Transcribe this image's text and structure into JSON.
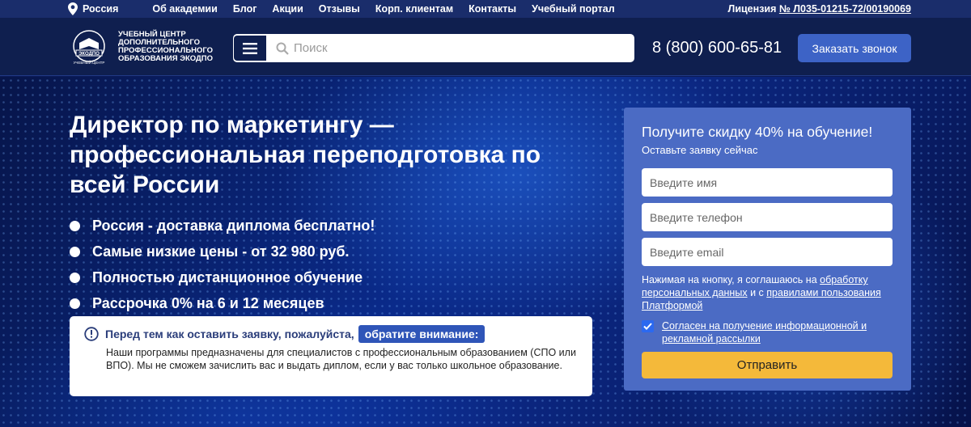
{
  "topbar": {
    "region": "Россия",
    "nav": [
      "Об академии",
      "Блог",
      "Акции",
      "Отзывы",
      "Корп. клиентам",
      "Контакты",
      "Учебный портал"
    ],
    "license_label": "Лицензия",
    "license_number": "№ Л035-01215-72/00190069"
  },
  "header": {
    "logo_text": "Учебный центр дополнительного профессионального образования Экодпо",
    "logo_emblem_text_top": "ЭКОДПО",
    "logo_emblem_text_bottom": "УЧЕБНЫЙ ЦЕНТР",
    "search_placeholder": "Поиск",
    "phone": "8 (800) 600-65-81",
    "call_button": "Заказать звонок"
  },
  "hero": {
    "title": "Директор по маркетингу — профессиональная переподготовка по всей России",
    "bullets": [
      "Россия - доставка диплома бесплатно!",
      "Самые низкие цены - от 32 980 руб.",
      "Полностью дистанционное обучение",
      "Рассрочка 0% на 6 и 12 месяцев"
    ],
    "notice": {
      "heading": "Перед тем как оставить заявку, пожалуйста,",
      "badge": "обратите внимание:",
      "body": "Наши программы предназначены для специалистов с профессиональным образованием (СПО или ВПО). Мы не сможем зачислить вас и выдать диплом, если у вас только школьное образование."
    }
  },
  "form": {
    "title": "Получите скидку 40% на обучение!",
    "subtitle": "Оставьте заявку сейчас",
    "name_placeholder": "Введите имя",
    "phone_placeholder": "Введите телефон",
    "email_placeholder": "Введите email",
    "consent_prefix": "Нажимая на кнопку, я соглашаюсь на",
    "consent_link1": "обработку персональных данных",
    "consent_middle": "и с",
    "consent_link2": "правилами пользования Платформой",
    "agree_text": "Согласен на получение информационной и рекламной рассылки",
    "agree_checked": true,
    "submit": "Отправить"
  },
  "colors": {
    "topbar_bg": "#1a2d6b",
    "header_bg": "#0f1f4f",
    "accent_blue": "#3d63c6",
    "form_bg": "#4b6bc4",
    "submit_bg": "#f4b93a"
  }
}
